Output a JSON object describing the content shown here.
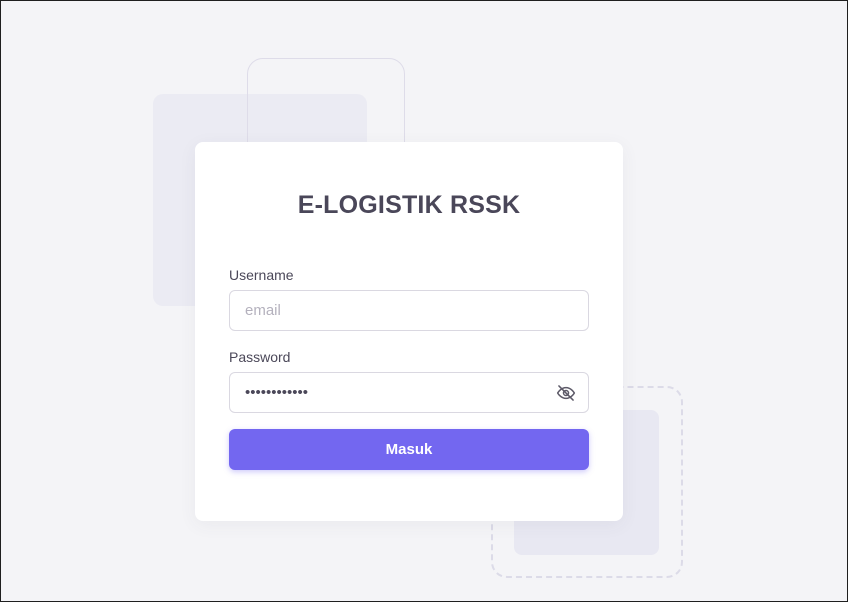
{
  "app": {
    "title": "E-LOGISTIK RSSK"
  },
  "login_form": {
    "username": {
      "label": "Username",
      "placeholder": "email",
      "value": ""
    },
    "password": {
      "label": "Password",
      "value": "............",
      "toggle_icon": "eye-off-icon"
    },
    "submit_label": "Masuk"
  },
  "colors": {
    "primary": "#7367f0",
    "background": "#f4f4f7",
    "card": "#ffffff",
    "title_text": "#4a4759",
    "decoration": "#ebebf3"
  }
}
